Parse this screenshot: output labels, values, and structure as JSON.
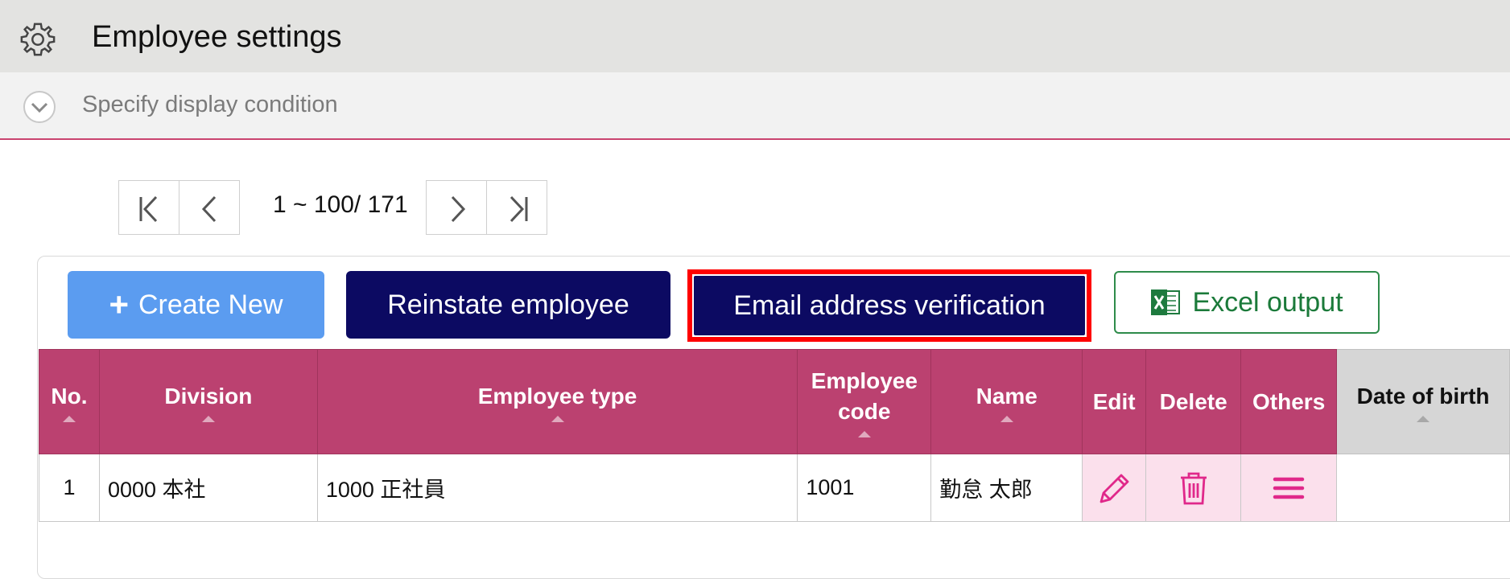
{
  "header": {
    "title": "Employee settings",
    "icon": "gear-icon"
  },
  "condition": {
    "label": "Specify display condition",
    "icon": "chevron-down-icon"
  },
  "pager": {
    "range": "1 ~ 100/ 171"
  },
  "toolbar": {
    "create_label": "Create New",
    "reinstate_label": "Reinstate employee",
    "email_label": "Email address verification",
    "excel_label": "Excel output"
  },
  "table": {
    "headers": {
      "no": "No.",
      "division": "Division",
      "employee_type": "Employee type",
      "employee_code_1": "Employee",
      "employee_code_2": "code",
      "name": "Name",
      "edit": "Edit",
      "delete": "Delete",
      "others": "Others",
      "dob": "Date of birth"
    },
    "rows": [
      {
        "no": "1",
        "division": "0000 本社",
        "employee_type": "1000 正社員",
        "employee_code": "1001",
        "name": "勤怠 太郎",
        "dob": ""
      }
    ]
  },
  "colors": {
    "header_bg": "#e3e3e1",
    "table_header": "#bb4170",
    "primary_dark": "#0c0a62",
    "primary_light": "#5b9cf0",
    "highlight": "#ff0000",
    "excel_green": "#1b7a3a",
    "action_cell": "#fbe0ec",
    "action_icon": "#e0288a"
  }
}
